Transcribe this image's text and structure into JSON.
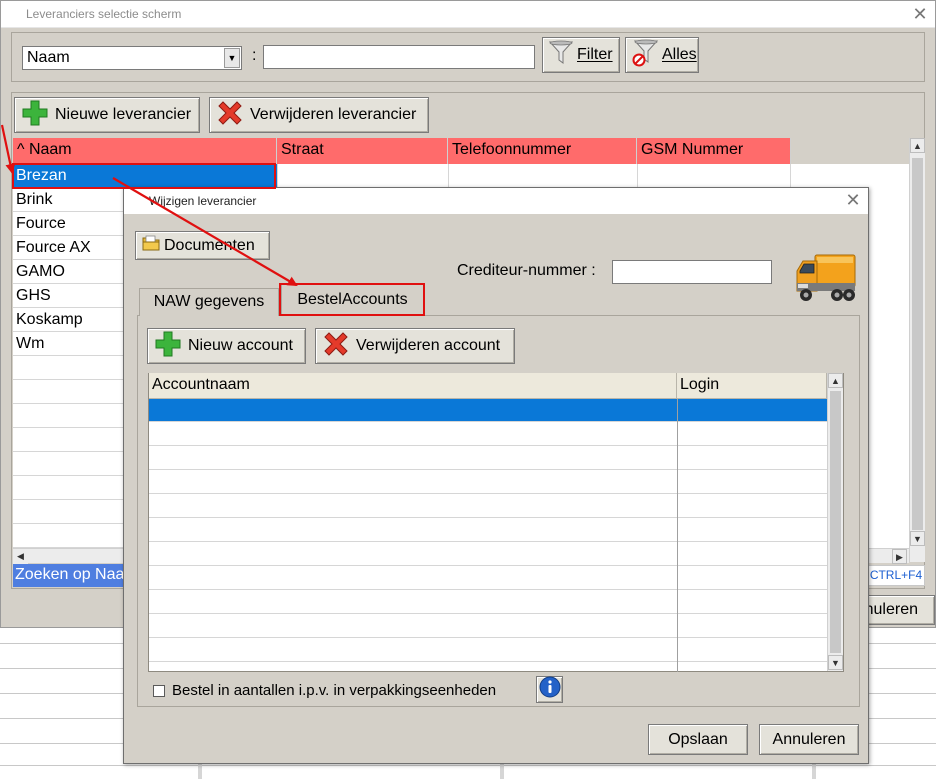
{
  "main_window": {
    "title": "Leveranciers selectie scherm",
    "filter": {
      "field_value": "Naam",
      "separator": ":",
      "search_value": "",
      "filter_label": "Filter",
      "all_label": "Alles"
    },
    "toolbar": {
      "new_label": "Nieuwe leverancier",
      "delete_label": "Verwijderen leverancier"
    },
    "columns": [
      "^ Naam",
      "Straat",
      "Telefoonnummer",
      "GSM Nummer"
    ],
    "rows": [
      "Brezan",
      "Brink",
      "Fource",
      "Fource AX",
      "GAMO",
      "GHS",
      "Koskamp",
      "Wm"
    ],
    "selected_row": "Brezan",
    "status_text": "Zoeken op Naa",
    "shortcut_hint": "CTRL+F4",
    "cancel_partial": "nuleren"
  },
  "dialog": {
    "title": "Wijzigen leverancier",
    "documents_label": "Documenten",
    "creditor_label": "Crediteur-nummer :",
    "creditor_value": "",
    "tabs": [
      "NAW gegevens",
      "BestelAccounts"
    ],
    "active_tab": "BestelAccounts",
    "new_account_label": "Nieuw account",
    "delete_account_label": "Verwijderen account",
    "grid_columns": [
      "Accountnaam",
      "Login"
    ],
    "checkbox_label": "Bestel in aantallen i.p.v. in verpakkingseenheden",
    "save_label": "Opslaan",
    "cancel_label": "Annuleren"
  },
  "colors": {
    "window_bg": "#d4d0c8",
    "grid_header": "#ff6b6b",
    "selection": "#0a78d7",
    "annotation": "#e01010",
    "status_bar": "#4f7ee0"
  }
}
